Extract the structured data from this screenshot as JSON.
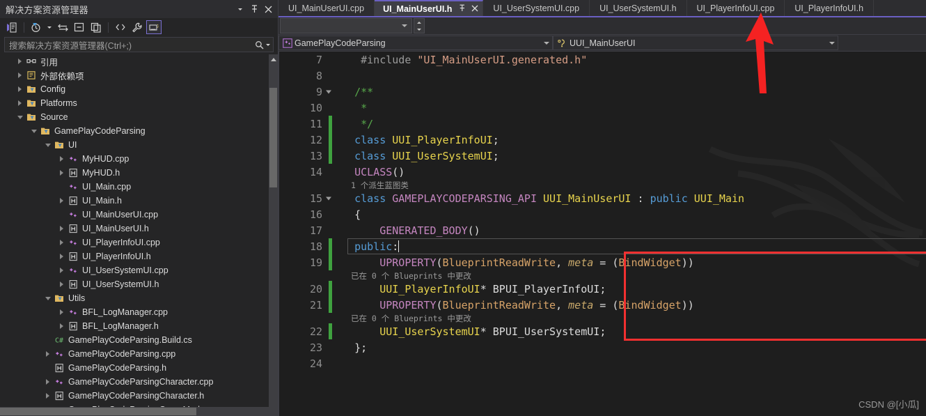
{
  "solution_explorer": {
    "title": "解决方案资源管理器",
    "titlebar_buttons": [
      {
        "name": "dropdown",
        "glyph": "▾"
      },
      {
        "name": "pin",
        "glyph": "⚲"
      },
      {
        "name": "close",
        "glyph": "✕"
      }
    ],
    "toolbar": [
      {
        "name": "home-view-icon",
        "label": "主页"
      },
      {
        "name": "pending-changes-icon",
        "label": "挂起的更改筛选器"
      },
      {
        "name": "sync-with-active-document-icon",
        "label": "与活动文档同步"
      },
      {
        "name": "collapse-all-icon",
        "label": "全部折叠"
      },
      {
        "name": "show-all-files-icon",
        "label": "显示所有文件"
      },
      {
        "name": "code-view-icon",
        "label": "查看代码"
      },
      {
        "name": "properties-icon",
        "label": "属性"
      },
      {
        "name": "preview-selected-items-icon",
        "label": "预览选定项"
      }
    ],
    "search": {
      "placeholder": "搜索解决方案资源管理器(Ctrl+;)",
      "icon": "search-icon"
    },
    "tree": [
      {
        "label": "引用",
        "indent": 2,
        "icon": "references",
        "expander": "closed"
      },
      {
        "label": "外部依赖项",
        "indent": 2,
        "icon": "external-deps",
        "expander": "closed"
      },
      {
        "label": "Config",
        "indent": 2,
        "icon": "folder",
        "expander": "closed"
      },
      {
        "label": "Platforms",
        "indent": 2,
        "icon": "folder",
        "expander": "closed"
      },
      {
        "label": "Source",
        "indent": 2,
        "icon": "folder",
        "expander": "open"
      },
      {
        "label": "GamePlayCodeParsing",
        "indent": 3,
        "icon": "folder",
        "expander": "open"
      },
      {
        "label": "UI",
        "indent": 4,
        "icon": "folder",
        "expander": "open"
      },
      {
        "label": "MyHUD.cpp",
        "indent": 5,
        "icon": "cpp",
        "expander": "closed"
      },
      {
        "label": "MyHUD.h",
        "indent": 5,
        "icon": "h",
        "expander": "closed"
      },
      {
        "label": "UI_Main.cpp",
        "indent": 5,
        "icon": "cpp",
        "expander": "none"
      },
      {
        "label": "UI_Main.h",
        "indent": 5,
        "icon": "h",
        "expander": "closed"
      },
      {
        "label": "UI_MainUserUI.cpp",
        "indent": 5,
        "icon": "cpp",
        "expander": "none"
      },
      {
        "label": "UI_MainUserUI.h",
        "indent": 5,
        "icon": "h",
        "expander": "closed"
      },
      {
        "label": "UI_PlayerInfoUI.cpp",
        "indent": 5,
        "icon": "cpp",
        "expander": "closed"
      },
      {
        "label": "UI_PlayerInfoUI.h",
        "indent": 5,
        "icon": "h",
        "expander": "closed"
      },
      {
        "label": "UI_UserSystemUI.cpp",
        "indent": 5,
        "icon": "cpp",
        "expander": "closed"
      },
      {
        "label": "UI_UserSystemUI.h",
        "indent": 5,
        "icon": "h",
        "expander": "closed"
      },
      {
        "label": "Utils",
        "indent": 4,
        "icon": "folder",
        "expander": "open"
      },
      {
        "label": "BFL_LogManager.cpp",
        "indent": 5,
        "icon": "cpp",
        "expander": "closed"
      },
      {
        "label": "BFL_LogManager.h",
        "indent": 5,
        "icon": "h",
        "expander": "closed"
      },
      {
        "label": "GamePlayCodeParsing.Build.cs",
        "indent": 4,
        "icon": "cs",
        "expander": "none"
      },
      {
        "label": "GamePlayCodeParsing.cpp",
        "indent": 4,
        "icon": "cpp",
        "expander": "closed"
      },
      {
        "label": "GamePlayCodeParsing.h",
        "indent": 4,
        "icon": "h",
        "expander": "none"
      },
      {
        "label": "GamePlayCodeParsingCharacter.cpp",
        "indent": 4,
        "icon": "cpp",
        "expander": "closed"
      },
      {
        "label": "GamePlayCodeParsingCharacter.h",
        "indent": 4,
        "icon": "h",
        "expander": "closed"
      },
      {
        "label": "GamePlayCodeParsingGameMode.cpp",
        "indent": 4,
        "icon": "cpp",
        "expander": "closed"
      }
    ]
  },
  "editor": {
    "tabs": [
      {
        "label": "UI_MainUserUI.cpp",
        "active": false
      },
      {
        "label": "UI_MainUserUI.h",
        "active": true,
        "pin_glyph": "⚲",
        "close_glyph": "✕"
      },
      {
        "label": "UI_UserSystemUI.cpp",
        "active": false
      },
      {
        "label": "UI_UserSystemUI.h",
        "active": false
      },
      {
        "label": "UI_PlayerInfoUI.cpp",
        "active": false
      },
      {
        "label": "UI_PlayerInfoUI.h",
        "active": false
      }
    ],
    "navbar": {
      "project": "GamePlayCodeParsing",
      "project_icon": "cpp-project-icon",
      "symbol": "UUI_MainUserUI",
      "symbol_icon": "class-icon"
    },
    "watermark": "CSDN @[小瓜]",
    "code_lines": [
      {
        "num": "7",
        "type": "code",
        "changed": false,
        "tokens": [
          {
            "t": "    ",
            "c": "k-id"
          },
          {
            "t": "#include ",
            "c": "k-pre"
          },
          {
            "t": "\"UI_MainUserUI.generated.h\"",
            "c": "k-str"
          }
        ]
      },
      {
        "num": "8",
        "type": "code",
        "changed": false,
        "tokens": []
      },
      {
        "num": "9",
        "type": "code",
        "changed": false,
        "fold": "open",
        "tokens": [
          {
            "t": "   ",
            "c": "k-id"
          },
          {
            "t": "/**",
            "c": "k-com"
          }
        ]
      },
      {
        "num": "10",
        "type": "code",
        "changed": false,
        "tokens": [
          {
            "t": "    ",
            "c": "k-id"
          },
          {
            "t": "*",
            "c": "k-com"
          }
        ]
      },
      {
        "num": "11",
        "type": "code",
        "changed": true,
        "tokens": [
          {
            "t": "    ",
            "c": "k-id"
          },
          {
            "t": "*/",
            "c": "k-com"
          }
        ]
      },
      {
        "num": "12",
        "type": "code",
        "changed": true,
        "tokens": [
          {
            "t": "   ",
            "c": "k-id"
          },
          {
            "t": "class",
            "c": "k-key"
          },
          {
            "t": " ",
            "c": "k-id"
          },
          {
            "t": "UUI_PlayerInfoUI",
            "c": "k-type"
          },
          {
            "t": ";",
            "c": "k-id"
          }
        ]
      },
      {
        "num": "13",
        "type": "code",
        "changed": true,
        "tokens": [
          {
            "t": "   ",
            "c": "k-id"
          },
          {
            "t": "class",
            "c": "k-key"
          },
          {
            "t": " ",
            "c": "k-id"
          },
          {
            "t": "UUI_UserSystemUI",
            "c": "k-type"
          },
          {
            "t": ";",
            "c": "k-id"
          }
        ]
      },
      {
        "num": "14",
        "type": "code",
        "changed": false,
        "tokens": [
          {
            "t": "   ",
            "c": "k-id"
          },
          {
            "t": "UCLASS",
            "c": "k-macro"
          },
          {
            "t": "()",
            "c": "k-id"
          }
        ]
      },
      {
        "num": "",
        "type": "hint",
        "text": "1 个派生蓝图类"
      },
      {
        "num": "15",
        "type": "code",
        "changed": false,
        "fold": "open",
        "tokens": [
          {
            "t": "   ",
            "c": "k-id"
          },
          {
            "t": "class",
            "c": "k-key"
          },
          {
            "t": " ",
            "c": "k-id"
          },
          {
            "t": "GAMEPLAYCODEPARSING_API",
            "c": "k-macro"
          },
          {
            "t": " ",
            "c": "k-id"
          },
          {
            "t": "UUI_MainUserUI",
            "c": "k-type"
          },
          {
            "t": " : ",
            "c": "k-id"
          },
          {
            "t": "public",
            "c": "k-key"
          },
          {
            "t": " ",
            "c": "k-id"
          },
          {
            "t": "UUI_Main",
            "c": "k-type"
          }
        ]
      },
      {
        "num": "16",
        "type": "code",
        "changed": false,
        "tokens": [
          {
            "t": "   {",
            "c": "k-id"
          }
        ]
      },
      {
        "num": "17",
        "type": "code",
        "changed": false,
        "tokens": [
          {
            "t": "       ",
            "c": "k-id"
          },
          {
            "t": "GENERATED_BODY",
            "c": "k-macro"
          },
          {
            "t": "()",
            "c": "k-id"
          }
        ]
      },
      {
        "num": "18",
        "type": "code",
        "changed": true,
        "cursor": true,
        "tokens": [
          {
            "t": "   ",
            "c": "k-id"
          },
          {
            "t": "public",
            "c": "k-key"
          },
          {
            "t": ":",
            "c": "k-id"
          }
        ]
      },
      {
        "num": "19",
        "type": "code",
        "changed": true,
        "tokens": [
          {
            "t": "       ",
            "c": "k-id"
          },
          {
            "t": "UPROPERTY",
            "c": "k-macro"
          },
          {
            "t": "(",
            "c": "k-id"
          },
          {
            "t": "BlueprintReadWrite",
            "c": "k-param"
          },
          {
            "t": ", ",
            "c": "k-id"
          },
          {
            "t": "meta",
            "c": "k-meta"
          },
          {
            "t": " = (",
            "c": "k-id"
          },
          {
            "t": "BindWidget",
            "c": "k-param"
          },
          {
            "t": "))",
            "c": "k-id"
          }
        ]
      },
      {
        "num": "",
        "type": "hint",
        "text": "已在 0 个 Blueprints 中更改"
      },
      {
        "num": "20",
        "type": "code",
        "changed": true,
        "tokens": [
          {
            "t": "       ",
            "c": "k-id"
          },
          {
            "t": "UUI_PlayerInfoUI",
            "c": "k-type"
          },
          {
            "t": "* ",
            "c": "k-id"
          },
          {
            "t": "BPUI_PlayerInfoUI",
            "c": "k-id"
          },
          {
            "t": ";",
            "c": "k-id"
          }
        ]
      },
      {
        "num": "21",
        "type": "code",
        "changed": true,
        "tokens": [
          {
            "t": "       ",
            "c": "k-id"
          },
          {
            "t": "UPROPERTY",
            "c": "k-macro"
          },
          {
            "t": "(",
            "c": "k-id"
          },
          {
            "t": "BlueprintReadWrite",
            "c": "k-param"
          },
          {
            "t": ", ",
            "c": "k-id"
          },
          {
            "t": "meta",
            "c": "k-meta"
          },
          {
            "t": " = (",
            "c": "k-id"
          },
          {
            "t": "BindWidget",
            "c": "k-param"
          },
          {
            "t": "))",
            "c": "k-id"
          }
        ]
      },
      {
        "num": "",
        "type": "hint",
        "text": "已在 0 个 Blueprints 中更改"
      },
      {
        "num": "22",
        "type": "code",
        "changed": true,
        "tokens": [
          {
            "t": "       ",
            "c": "k-id"
          },
          {
            "t": "UUI_UserSystemUI",
            "c": "k-type"
          },
          {
            "t": "* ",
            "c": "k-id"
          },
          {
            "t": "BPUI_UserSystemUI",
            "c": "k-id"
          },
          {
            "t": ";",
            "c": "k-id"
          }
        ]
      },
      {
        "num": "23",
        "type": "code",
        "changed": false,
        "tokens": [
          {
            "t": "   };",
            "c": "k-id"
          }
        ]
      },
      {
        "num": "24",
        "type": "code",
        "changed": false,
        "tokens": []
      }
    ]
  },
  "colors": {
    "accent": "#6a5fc2",
    "annotation_red": "#f23030",
    "changed_green": "#3fa23f",
    "editor_bg": "#1e1e1e",
    "panel_bg": "#252526",
    "chrome_bg": "#2d2d30"
  }
}
